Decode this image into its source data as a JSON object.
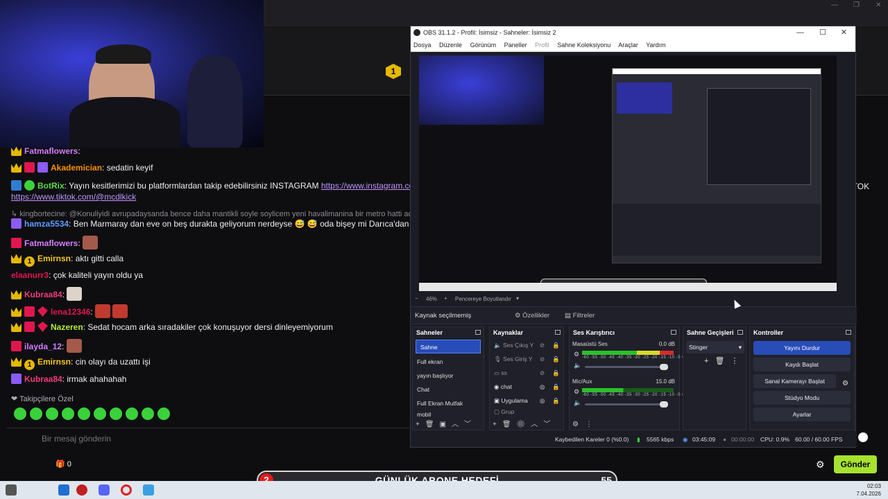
{
  "chat": {
    "lines": [
      {
        "user": "Fatmaflowers",
        "sep": ":",
        "text": ""
      },
      {
        "user": "Akademician",
        "sep": ":",
        "text": " sedatin keyif"
      },
      {
        "user": "BotRix",
        "sep": ":",
        "text": " Yayın kesitlerimizi bu platformlardan takip edebilirsiniz INSTAGRAM ",
        "link1": "https://www.instagram.com/mcdlkick"
      },
      {
        "link2": "https://www.tiktok.com/@mcdlkick"
      },
      {
        "text": "↳ kingbortecine: @Konuliyidi avrupadaysanda bence daha mantikli soyle soylicem yeni havalimanina bir metro hatti aci"
      },
      {
        "user": "hamza5534",
        "sep": ":",
        "text": " Ben Marmaray dan eve on beş durakta geliyorum nerdeyse 😅 😅 oda bişey mi Darıca'dan"
      },
      {
        "user": "Fatmaflowers",
        "sep": ":",
        "text": ""
      },
      {
        "user": "Emirnsn",
        "sep": ":",
        "text": " aktı gitti calla"
      },
      {
        "user": "elaanurr3",
        "sep": ":",
        "text": " çok kaliteli yayın oldu ya"
      },
      {
        "user": "Kubraa84",
        "sep": ":",
        "text": ""
      },
      {
        "user": "lena12346",
        "sep": ":",
        "text": ""
      },
      {
        "user": "Nazeren",
        "sep": ":",
        "text": " Sedat hocam arka sıradakiler çok konuşuyor dersi dinleyemiyorum"
      },
      {
        "user": "ilayda_12",
        "sep": ":",
        "text": ""
      },
      {
        "user": "Emirnsn",
        "sep": ":",
        "text": " cin olayı da uzattı işi"
      },
      {
        "user": "Kubraa84",
        "sep": ":",
        "text": " irmak ahahahah"
      }
    ],
    "followers_only": "Takipçilere Özel",
    "input_placeholder": "Bir mesaj gönderin",
    "send_label": "Gönder",
    "point_count": "0",
    "right_edge_text": "TIKTOK"
  },
  "obs": {
    "title": "OBS 31.1.2 - Profil: İsimsiz - Sahneler: İsimsiz 2",
    "menu": [
      "Dosya",
      "Düzenle",
      "Görünüm",
      "Paneller",
      "Profil",
      "Sahne Koleksiyonu",
      "Araçlar",
      "Yardım"
    ],
    "zoom": "46%",
    "zoom_fit": "Pencereye Boyutlandır",
    "no_source": "Kaynak seçilmemiş",
    "properties": "Özellikler",
    "filters": "Filtreler",
    "scenes_title": "Sahneler",
    "scenes": [
      "Sahne",
      "Full ekran",
      "yayın başlıyor",
      "Chat",
      "Full Ekran Mutfak",
      "mobil"
    ],
    "sources_title": "Kaynaklar",
    "sources": [
      "Ses Çıkış Y",
      "Ses Giriş Y",
      "ss",
      "chat",
      "Uygulama",
      "Grup"
    ],
    "mixer_title": "Ses Karıştırıcı",
    "mixer": [
      {
        "name": "Masaüstü Ses",
        "db": "0.0 dB"
      },
      {
        "name": "Mic/Aux",
        "db": "15.0 dB"
      }
    ],
    "meter_ticks": "-60 -55 -50 -45 -40 -35 -30 -25 -20 -15 -10 -5 0",
    "transitions_title": "Sahne Geçişleri",
    "transition": "Stinger",
    "controls_title": "Kontroller",
    "controls": [
      "Yayını Durdur",
      "Kaydı Başlat",
      "Sanal Kamerayı Başlat",
      "Stüdyo Modu",
      "Ayarlar"
    ],
    "status": {
      "dropped": "Kaybedilen Kareler 0 (%0.0)",
      "bitrate": "5565 kbps",
      "live_time": "03:45:09",
      "rec_time": "00:00:00",
      "cpu": "CPU: 0.9%",
      "fps": "60.00 / 60.00 FPS"
    }
  },
  "goal": {
    "number": "2",
    "label": "GÜNLÜK ABONE HEDEFİ",
    "count": "55"
  },
  "taskbar": {
    "time": "02:03",
    "date": "7.04.2026"
  },
  "colors": {
    "obs_accent": "#284cb8",
    "send": "#a6e22e",
    "goal_red": "#e21b1b"
  }
}
